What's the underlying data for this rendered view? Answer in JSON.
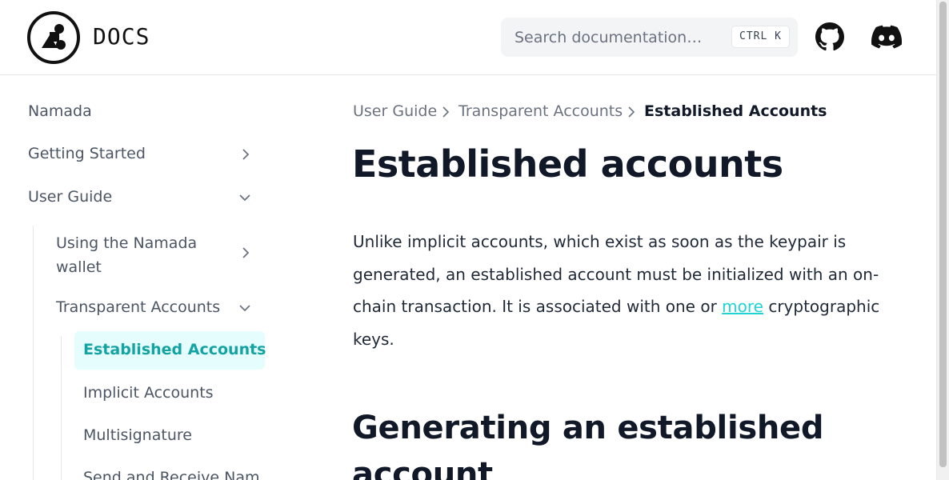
{
  "header": {
    "logo_text": "DOCS",
    "search_placeholder": "Search documentation…",
    "shortcut": "CTRL K",
    "icons": [
      "logo-icon",
      "github-icon",
      "discord-icon"
    ]
  },
  "sidebar": {
    "items": [
      {
        "label": "Namada"
      },
      {
        "label": "Getting Started"
      },
      {
        "label": "User Guide"
      },
      {
        "label": "Using the Namada wallet",
        "lines": [
          "Using the Namada",
          "wallet"
        ]
      },
      {
        "label": "Transparent Accounts"
      },
      {
        "label": "Established Accounts",
        "active": true
      },
      {
        "label": "Implicit Accounts"
      },
      {
        "label": "Multisignature"
      },
      {
        "label": "Send and Receive Nam"
      }
    ]
  },
  "breadcrumb": [
    "User Guide",
    "Transparent Accounts",
    "Established Accounts"
  ],
  "main": {
    "title": "Established accounts",
    "paragraph_before_link": "Unlike implicit accounts, which exist as soon as the keypair is generated, an established account must be initialized with an on-chain transaction. It is associated with one or ",
    "link_text": "more",
    "paragraph_after_link": " cryptographic keys.",
    "heading2": "Generating an established account"
  },
  "colors": {
    "accent": "#14a3a3",
    "active_bg": "#e6fdfd",
    "link": "#22d3d3"
  }
}
